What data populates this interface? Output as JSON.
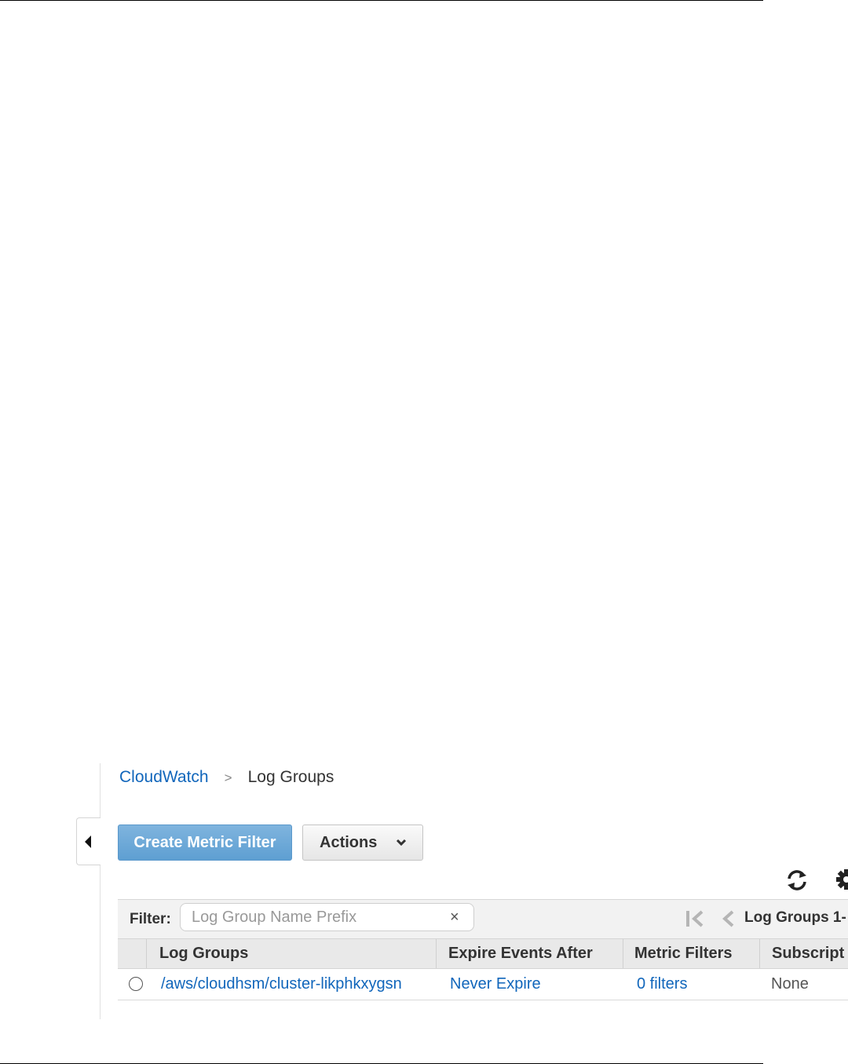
{
  "breadcrumb": {
    "root": "CloudWatch",
    "separator": ">",
    "current": "Log Groups"
  },
  "toolbar": {
    "create_metric_filter_label": "Create Metric Filter",
    "actions_label": "Actions"
  },
  "filter": {
    "label": "Filter:",
    "placeholder": "Log Group Name Prefix",
    "value": "",
    "clear_symbol": "×",
    "pagination_label": "Log Groups 1-"
  },
  "table": {
    "columns": [
      "Log Groups",
      "Expire Events After",
      "Metric Filters",
      "Subscript"
    ],
    "rows": [
      {
        "selected": false,
        "log_group": "/aws/cloudhsm/cluster-likphkxygsn",
        "expire_events_after": "Never Expire",
        "metric_filters": "0 filters",
        "subscriptions": "None"
      }
    ]
  },
  "icons": {
    "sidebar_toggle": "triangle-left-icon",
    "actions_caret": "chevron-down-icon",
    "refresh": "refresh-icon",
    "settings": "gear-icon",
    "first_page": "first-page-icon",
    "prev_page": "chevron-left-icon"
  },
  "colors": {
    "link": "#1166bb",
    "primary_button": "#6aa7d8",
    "header_bg": "#e9e9e9",
    "filter_bg": "#f2f2f2"
  }
}
